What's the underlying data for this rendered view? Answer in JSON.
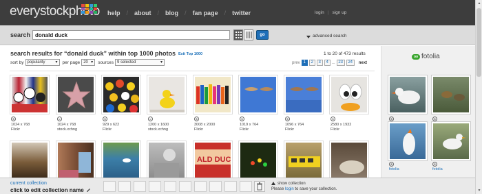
{
  "brand": {
    "logo_text": "everystockphoto"
  },
  "nav": {
    "items": [
      "help",
      "about",
      "blog",
      "fan page",
      "twitter"
    ]
  },
  "auth": {
    "login": "login",
    "signup": "sign up"
  },
  "search": {
    "label": "search",
    "value": "donald duck",
    "go_label": "go",
    "advanced_label": "advanced search"
  },
  "results": {
    "title": "search results for “donald duck” within top 1000 photos",
    "exit_link": "Exit Top 1000",
    "count": "1 to 20 of 473 results",
    "sort_label": "sort by",
    "sort_value": "popularity",
    "perpage_label": "per page",
    "perpage_value": "20",
    "sources_label": "sources",
    "sources_value": "9 selected"
  },
  "pager": {
    "prev": "prev",
    "pages": [
      "1",
      "2",
      "3",
      "4",
      "...",
      "23",
      "24"
    ],
    "current": "1",
    "next": "next"
  },
  "thumbs": [
    {
      "size": "1024 x 768",
      "source": "Flickr"
    },
    {
      "size": "1024 x 768",
      "source": "stock.xchng"
    },
    {
      "size": "929 x 622",
      "source": "Flickr"
    },
    {
      "size": "1200 x 1600",
      "source": "stock.xchng"
    },
    {
      "size": "3008 x 2000",
      "source": "Flickr"
    },
    {
      "size": "1019 x 764",
      "source": "Flickr"
    },
    {
      "size": "1096 x 764",
      "source": "Flickr"
    },
    {
      "size": "2580 x 1932",
      "source": "Flickr"
    }
  ],
  "fotolia": {
    "logo_text": "fotolia",
    "badge": "oo",
    "items": [
      "fotolia",
      "fotolia",
      "fotolia",
      "fotolia"
    ]
  },
  "collection": {
    "current_label": "current collection",
    "edit_label": "click to edit collection name",
    "show_label": "show collection",
    "save_prefix": "Please",
    "save_link": "login",
    "save_suffix": "to save your collection."
  },
  "colors": {
    "brand_bar": "#3d3d3d",
    "accent": "#1f6fb8",
    "fotolia_green": "#3aa52e"
  }
}
